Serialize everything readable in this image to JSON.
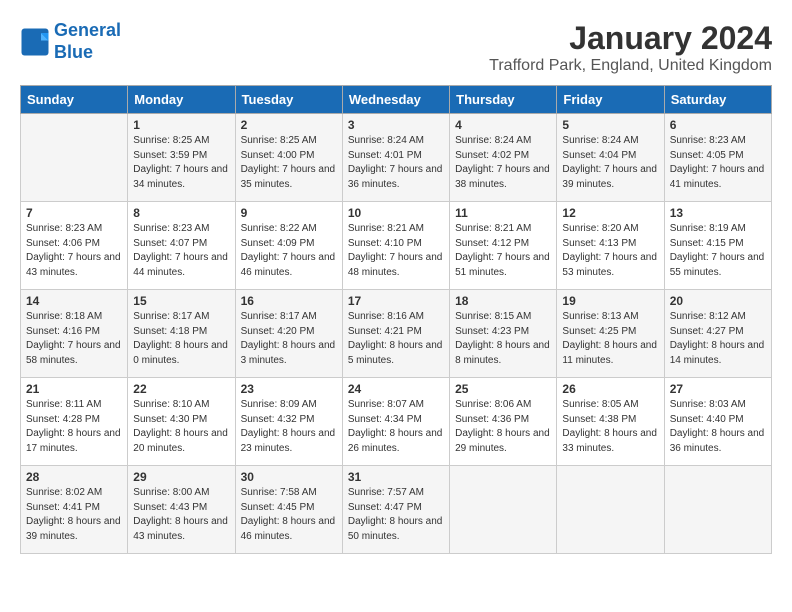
{
  "logo": {
    "line1": "General",
    "line2": "Blue"
  },
  "title": "January 2024",
  "subtitle": "Trafford Park, England, United Kingdom",
  "headers": [
    "Sunday",
    "Monday",
    "Tuesday",
    "Wednesday",
    "Thursday",
    "Friday",
    "Saturday"
  ],
  "weeks": [
    [
      {
        "day": "",
        "sunrise": "",
        "sunset": "",
        "daylight": ""
      },
      {
        "day": "1",
        "sunrise": "Sunrise: 8:25 AM",
        "sunset": "Sunset: 3:59 PM",
        "daylight": "Daylight: 7 hours and 34 minutes."
      },
      {
        "day": "2",
        "sunrise": "Sunrise: 8:25 AM",
        "sunset": "Sunset: 4:00 PM",
        "daylight": "Daylight: 7 hours and 35 minutes."
      },
      {
        "day": "3",
        "sunrise": "Sunrise: 8:24 AM",
        "sunset": "Sunset: 4:01 PM",
        "daylight": "Daylight: 7 hours and 36 minutes."
      },
      {
        "day": "4",
        "sunrise": "Sunrise: 8:24 AM",
        "sunset": "Sunset: 4:02 PM",
        "daylight": "Daylight: 7 hours and 38 minutes."
      },
      {
        "day": "5",
        "sunrise": "Sunrise: 8:24 AM",
        "sunset": "Sunset: 4:04 PM",
        "daylight": "Daylight: 7 hours and 39 minutes."
      },
      {
        "day": "6",
        "sunrise": "Sunrise: 8:23 AM",
        "sunset": "Sunset: 4:05 PM",
        "daylight": "Daylight: 7 hours and 41 minutes."
      }
    ],
    [
      {
        "day": "7",
        "sunrise": "Sunrise: 8:23 AM",
        "sunset": "Sunset: 4:06 PM",
        "daylight": "Daylight: 7 hours and 43 minutes."
      },
      {
        "day": "8",
        "sunrise": "Sunrise: 8:23 AM",
        "sunset": "Sunset: 4:07 PM",
        "daylight": "Daylight: 7 hours and 44 minutes."
      },
      {
        "day": "9",
        "sunrise": "Sunrise: 8:22 AM",
        "sunset": "Sunset: 4:09 PM",
        "daylight": "Daylight: 7 hours and 46 minutes."
      },
      {
        "day": "10",
        "sunrise": "Sunrise: 8:21 AM",
        "sunset": "Sunset: 4:10 PM",
        "daylight": "Daylight: 7 hours and 48 minutes."
      },
      {
        "day": "11",
        "sunrise": "Sunrise: 8:21 AM",
        "sunset": "Sunset: 4:12 PM",
        "daylight": "Daylight: 7 hours and 51 minutes."
      },
      {
        "day": "12",
        "sunrise": "Sunrise: 8:20 AM",
        "sunset": "Sunset: 4:13 PM",
        "daylight": "Daylight: 7 hours and 53 minutes."
      },
      {
        "day": "13",
        "sunrise": "Sunrise: 8:19 AM",
        "sunset": "Sunset: 4:15 PM",
        "daylight": "Daylight: 7 hours and 55 minutes."
      }
    ],
    [
      {
        "day": "14",
        "sunrise": "Sunrise: 8:18 AM",
        "sunset": "Sunset: 4:16 PM",
        "daylight": "Daylight: 7 hours and 58 minutes."
      },
      {
        "day": "15",
        "sunrise": "Sunrise: 8:17 AM",
        "sunset": "Sunset: 4:18 PM",
        "daylight": "Daylight: 8 hours and 0 minutes."
      },
      {
        "day": "16",
        "sunrise": "Sunrise: 8:17 AM",
        "sunset": "Sunset: 4:20 PM",
        "daylight": "Daylight: 8 hours and 3 minutes."
      },
      {
        "day": "17",
        "sunrise": "Sunrise: 8:16 AM",
        "sunset": "Sunset: 4:21 PM",
        "daylight": "Daylight: 8 hours and 5 minutes."
      },
      {
        "day": "18",
        "sunrise": "Sunrise: 8:15 AM",
        "sunset": "Sunset: 4:23 PM",
        "daylight": "Daylight: 8 hours and 8 minutes."
      },
      {
        "day": "19",
        "sunrise": "Sunrise: 8:13 AM",
        "sunset": "Sunset: 4:25 PM",
        "daylight": "Daylight: 8 hours and 11 minutes."
      },
      {
        "day": "20",
        "sunrise": "Sunrise: 8:12 AM",
        "sunset": "Sunset: 4:27 PM",
        "daylight": "Daylight: 8 hours and 14 minutes."
      }
    ],
    [
      {
        "day": "21",
        "sunrise": "Sunrise: 8:11 AM",
        "sunset": "Sunset: 4:28 PM",
        "daylight": "Daylight: 8 hours and 17 minutes."
      },
      {
        "day": "22",
        "sunrise": "Sunrise: 8:10 AM",
        "sunset": "Sunset: 4:30 PM",
        "daylight": "Daylight: 8 hours and 20 minutes."
      },
      {
        "day": "23",
        "sunrise": "Sunrise: 8:09 AM",
        "sunset": "Sunset: 4:32 PM",
        "daylight": "Daylight: 8 hours and 23 minutes."
      },
      {
        "day": "24",
        "sunrise": "Sunrise: 8:07 AM",
        "sunset": "Sunset: 4:34 PM",
        "daylight": "Daylight: 8 hours and 26 minutes."
      },
      {
        "day": "25",
        "sunrise": "Sunrise: 8:06 AM",
        "sunset": "Sunset: 4:36 PM",
        "daylight": "Daylight: 8 hours and 29 minutes."
      },
      {
        "day": "26",
        "sunrise": "Sunrise: 8:05 AM",
        "sunset": "Sunset: 4:38 PM",
        "daylight": "Daylight: 8 hours and 33 minutes."
      },
      {
        "day": "27",
        "sunrise": "Sunrise: 8:03 AM",
        "sunset": "Sunset: 4:40 PM",
        "daylight": "Daylight: 8 hours and 36 minutes."
      }
    ],
    [
      {
        "day": "28",
        "sunrise": "Sunrise: 8:02 AM",
        "sunset": "Sunset: 4:41 PM",
        "daylight": "Daylight: 8 hours and 39 minutes."
      },
      {
        "day": "29",
        "sunrise": "Sunrise: 8:00 AM",
        "sunset": "Sunset: 4:43 PM",
        "daylight": "Daylight: 8 hours and 43 minutes."
      },
      {
        "day": "30",
        "sunrise": "Sunrise: 7:58 AM",
        "sunset": "Sunset: 4:45 PM",
        "daylight": "Daylight: 8 hours and 46 minutes."
      },
      {
        "day": "31",
        "sunrise": "Sunrise: 7:57 AM",
        "sunset": "Sunset: 4:47 PM",
        "daylight": "Daylight: 8 hours and 50 minutes."
      },
      {
        "day": "",
        "sunrise": "",
        "sunset": "",
        "daylight": ""
      },
      {
        "day": "",
        "sunrise": "",
        "sunset": "",
        "daylight": ""
      },
      {
        "day": "",
        "sunrise": "",
        "sunset": "",
        "daylight": ""
      }
    ]
  ]
}
